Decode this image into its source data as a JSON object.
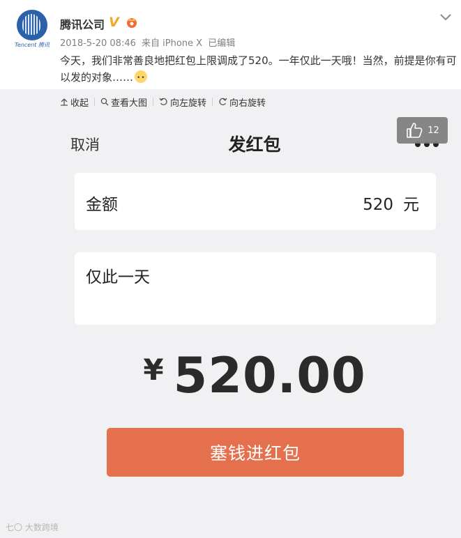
{
  "post": {
    "user_name": "腾讯公司",
    "avatar_caption": "Tencent 腾讯",
    "timestamp": "2018-5-20 08:46",
    "source": "来自 iPhone X",
    "edited": "已编辑",
    "text": "今天，我们非常善良地把红包上限调成了520。一年仅此一天哦！当然，前提是你有可以发的对象……"
  },
  "toolbar": {
    "collapse_label": "收起",
    "view_large_label": "查看大图",
    "rotate_left_label": "向左旋转",
    "rotate_right_label": "向右旋转"
  },
  "like": {
    "count": "12"
  },
  "red_packet": {
    "cancel_label": "取消",
    "title": "发红包",
    "amount_label": "金额",
    "amount_value": "520",
    "amount_unit": "元",
    "message": "仅此一天",
    "currency_symbol": "¥",
    "total": "520.00",
    "send_label": "塞钱进红包"
  },
  "watermark": "七〇 大数跨境",
  "colors": {
    "button": "#e4704e",
    "background": "#f1f1f3",
    "brand_blue": "#2a61a9"
  }
}
